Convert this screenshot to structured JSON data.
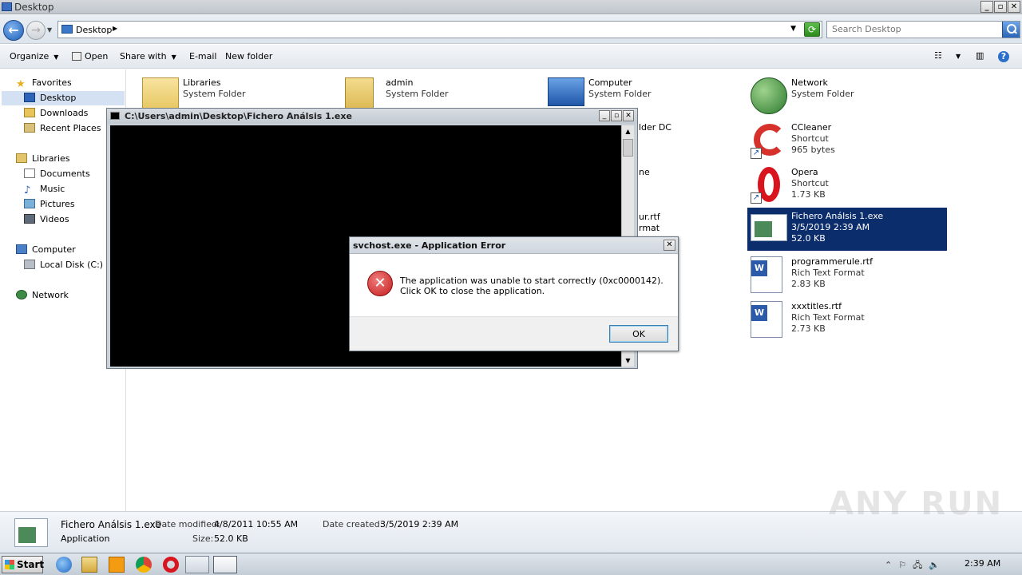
{
  "window": {
    "title": "Desktop"
  },
  "address": {
    "crumb": "Desktop",
    "search_placeholder": "Search Desktop"
  },
  "toolbar": {
    "organize": "Organize",
    "open": "Open",
    "share_with": "Share with",
    "email": "E-mail",
    "new_folder": "New folder"
  },
  "nav": {
    "favorites": "Favorites",
    "desktop": "Desktop",
    "downloads": "Downloads",
    "recent": "Recent Places",
    "libraries": "Libraries",
    "documents": "Documents",
    "music": "Music",
    "pictures": "Pictures",
    "videos": "Videos",
    "computer": "Computer",
    "local_disk": "Local Disk (C:)",
    "network": "Network"
  },
  "items": {
    "libraries": {
      "name": "Libraries",
      "type": "System Folder"
    },
    "admin": {
      "name": "admin",
      "type": "System Folder"
    },
    "computer": {
      "name": "Computer",
      "type": "System Folder"
    },
    "computer_partial": "lder DC",
    "partial_ne": "ne",
    "partial_rtf_name": "ur.rtf",
    "partial_rtf_type": "rmat",
    "network": {
      "name": "Network",
      "type": "System Folder"
    },
    "ccleaner": {
      "name": "CCleaner",
      "type": "Shortcut",
      "size": "965 bytes"
    },
    "opera": {
      "name": "Opera",
      "type": "Shortcut",
      "size": "1.73 KB"
    },
    "fichero": {
      "name": "Fichero Análsis 1.exe",
      "date": "3/5/2019 2:39 AM",
      "size": "52.0 KB"
    },
    "programmerule": {
      "name": "programmerule.rtf",
      "type": "Rich Text Format",
      "size": "2.83 KB"
    },
    "xxxtitles": {
      "name": "xxxtitles.rtf",
      "type": "Rich Text Format",
      "size": "2.73 KB"
    }
  },
  "console": {
    "title": "C:\\Users\\admin\\Desktop\\Fichero Análsis 1.exe"
  },
  "dialog": {
    "title": "svchost.exe - Application Error",
    "message": "The application was unable to start correctly (0xc0000142). Click OK to close the application.",
    "ok": "OK"
  },
  "details": {
    "name": "Fichero Análsis 1.exe",
    "kind": "Application",
    "modified_label": "Date modified:",
    "modified": "4/8/2011 10:55 AM",
    "created_label": "Date created:",
    "created": "3/5/2019 2:39 AM",
    "size_label": "Size:",
    "size": "52.0 KB"
  },
  "watermark": "ANY RUN",
  "taskbar": {
    "start": "Start",
    "clock": "2:39 AM"
  }
}
